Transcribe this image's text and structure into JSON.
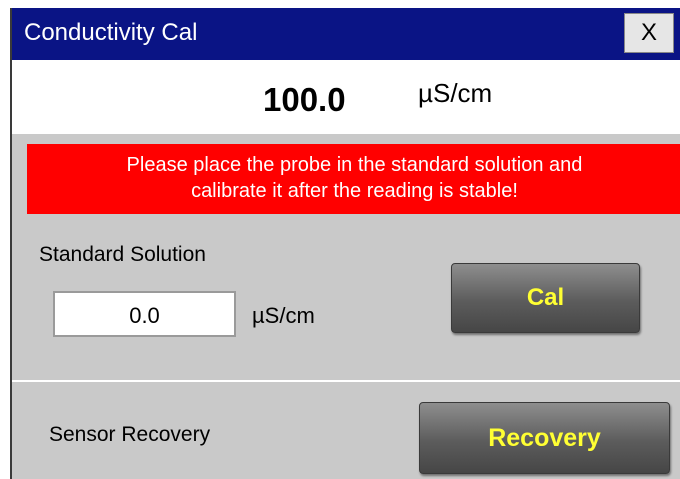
{
  "window": {
    "title": "Conductivity Cal",
    "close_label": "X"
  },
  "reading": {
    "value": "100.0",
    "unit": "µS/cm"
  },
  "warning": {
    "line1": "Please place the probe in the standard solution and",
    "line2": "calibrate it after the reading is stable!"
  },
  "standard_solution": {
    "label": "Standard Solution",
    "value": "0.0",
    "unit": "µS/cm"
  },
  "cal_button": {
    "label": "Cal"
  },
  "recovery": {
    "label": "Sensor Recovery",
    "button_label": "Recovery"
  },
  "colors": {
    "titlebar": "#0a1485",
    "warning_bg": "#ff0000",
    "button_text": "#ffff33",
    "panel_bg": "#c9c9c9"
  }
}
